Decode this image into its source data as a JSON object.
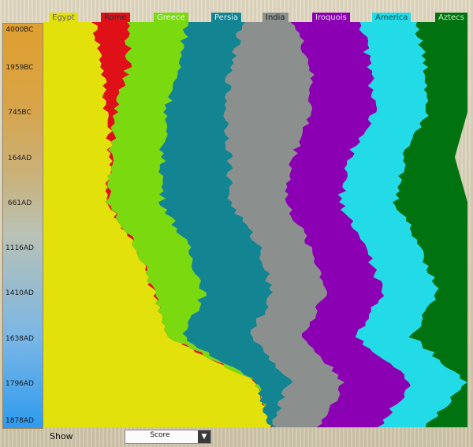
{
  "timeline": {
    "labels": [
      "4000BC",
      "1959BC",
      "745BC",
      "164AD",
      "661AD",
      "1116AD",
      "1410AD",
      "1638AD",
      "1796AD",
      "1878AD"
    ]
  },
  "civilizations": [
    {
      "name": "Egypt",
      "color": "#e2e10c",
      "text": "#666"
    },
    {
      "name": "Rome",
      "color": "#e01018",
      "text": "#333"
    },
    {
      "name": "Greece",
      "color": "#7ad90f",
      "text": "#f6f6f6"
    },
    {
      "name": "Persia",
      "color": "#138592",
      "text": "#d0f1f5"
    },
    {
      "name": "India",
      "color": "#8b8f8d",
      "text": "#222"
    },
    {
      "name": "Iroquois",
      "color": "#8a00b2",
      "text": "#f3d9ff"
    },
    {
      "name": "America",
      "color": "#22dbe6",
      "text": "#0f4d55"
    },
    {
      "name": "Aztecs",
      "color": "#00720f",
      "text": "#c8f7c8"
    }
  ],
  "controls": {
    "show_label": "Show",
    "show_value": "Score"
  },
  "chart_data": {
    "type": "area",
    "title": "",
    "xlabel": "",
    "ylabel": "",
    "x": [
      "4000BC",
      "1959BC",
      "745BC",
      "164AD",
      "661AD",
      "1116AD",
      "1410AD",
      "1638AD",
      "1796AD",
      "1878AD"
    ],
    "series": [
      {
        "name": "Egypt",
        "values": [
          0.12,
          0.14,
          0.15,
          0.16,
          0.15,
          0.22,
          0.26,
          0.3,
          0.5,
          0.54
        ]
      },
      {
        "name": "Rome",
        "values": [
          0.08,
          0.06,
          0.02,
          0.0,
          0.0,
          0.0,
          0.0,
          0.0,
          0.0,
          0.0
        ]
      },
      {
        "name": "Greece",
        "values": [
          0.14,
          0.12,
          0.12,
          0.12,
          0.13,
          0.12,
          0.12,
          0.03,
          0.0,
          0.0
        ]
      },
      {
        "name": "Persia",
        "values": [
          0.13,
          0.12,
          0.14,
          0.16,
          0.16,
          0.17,
          0.16,
          0.16,
          0.08,
          0.0
        ]
      },
      {
        "name": "India",
        "values": [
          0.12,
          0.19,
          0.2,
          0.15,
          0.13,
          0.12,
          0.13,
          0.12,
          0.13,
          0.11
        ]
      },
      {
        "name": "Iroquois",
        "values": [
          0.16,
          0.14,
          0.15,
          0.13,
          0.13,
          0.13,
          0.13,
          0.13,
          0.16,
          0.14
        ]
      },
      {
        "name": "America",
        "values": [
          0.13,
          0.13,
          0.13,
          0.13,
          0.13,
          0.13,
          0.13,
          0.13,
          0.13,
          0.11
        ]
      },
      {
        "name": "Aztecs",
        "values": [
          0.12,
          0.1,
          0.09,
          0.12,
          0.17,
          0.11,
          0.07,
          0.13,
          0.01,
          0.1
        ]
      }
    ],
    "ylim": [
      0,
      1
    ]
  }
}
